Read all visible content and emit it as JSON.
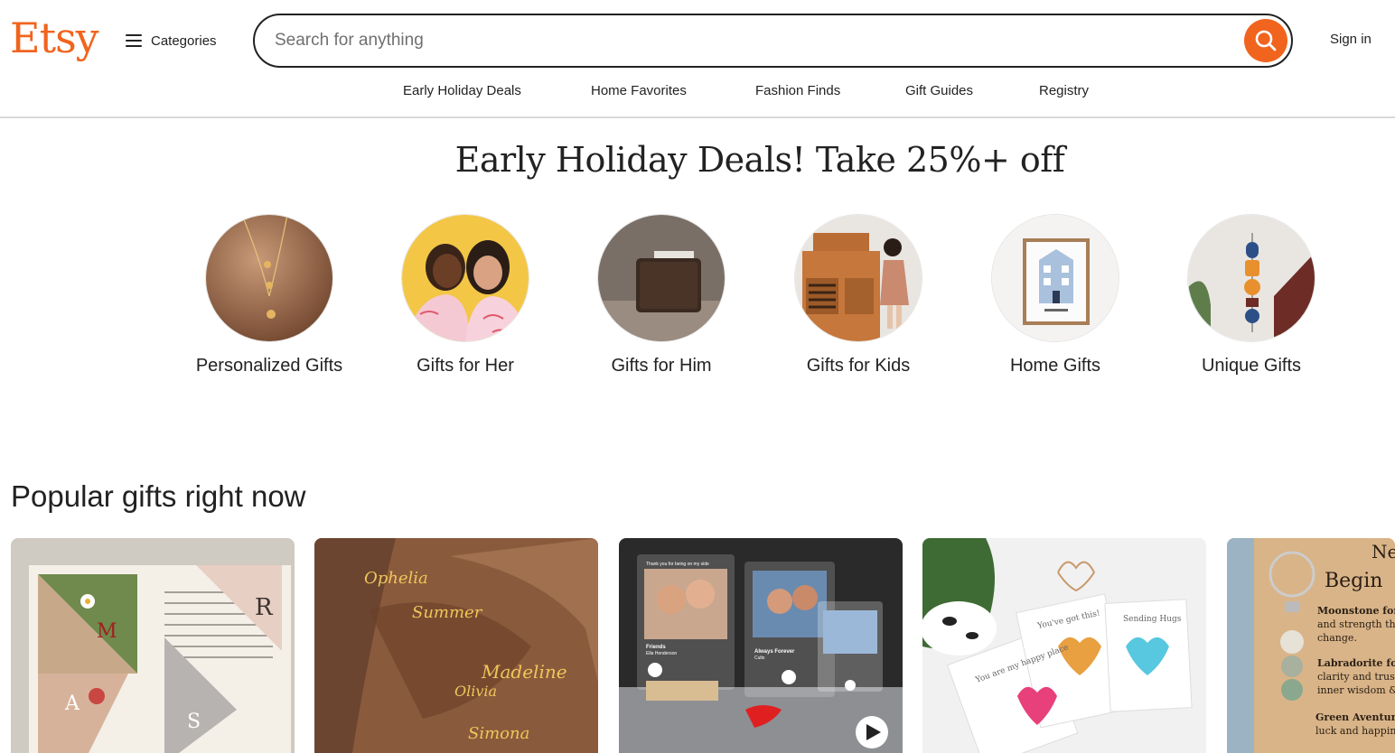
{
  "header": {
    "logo": "Etsy",
    "categories_label": "Categories",
    "search_placeholder": "Search for anything",
    "signin_label": "Sign in"
  },
  "nav": [
    "Early Holiday Deals",
    "Home Favorites",
    "Fashion Finds",
    "Gift Guides",
    "Registry"
  ],
  "banner": {
    "title": "Early Holiday Deals! Take 25%+ off",
    "categories": [
      {
        "label": "Personalized Gifts",
        "icon": "necklace-photo"
      },
      {
        "label": "Gifts for Her",
        "icon": "women-pajamas-photo"
      },
      {
        "label": "Gifts for Him",
        "icon": "wallet-photo"
      },
      {
        "label": "Gifts for Kids",
        "icon": "play-kitchen-photo"
      },
      {
        "label": "Home Gifts",
        "icon": "house-print-photo"
      },
      {
        "label": "Unique Gifts",
        "icon": "wall-hanging-photo"
      }
    ]
  },
  "popular": {
    "title": "Popular gifts right now",
    "items": [
      {
        "name": "embroidered-bookmark-photo",
        "letters": [
          "M",
          "A",
          "S",
          "R"
        ]
      },
      {
        "name": "name-necklace-photo",
        "names": [
          "Ophelia",
          "Summer",
          "Madeline",
          "Olivia",
          "Simona"
        ]
      },
      {
        "name": "music-plaque-photo",
        "labels": [
          "Thank you for being on my side",
          "Friends",
          "Ella Henderson",
          "Always Forever",
          "Cults"
        ]
      },
      {
        "name": "glass-heart-cards-photo",
        "labels": [
          "You are my happy place",
          "You've got this!",
          "Sending Hugs"
        ]
      },
      {
        "name": "moonstone-keychain-photo",
        "labels": [
          "Ne",
          "Begin",
          "Moonstone for",
          "and strength th",
          "change.",
          "Labradorite for",
          "clarity and trust",
          "inner wisdom &",
          "Green Aventur",
          "luck and happin"
        ]
      }
    ]
  },
  "colors": {
    "brand": "#F1641E",
    "text": "#222222",
    "border": "#d9d9d9"
  }
}
